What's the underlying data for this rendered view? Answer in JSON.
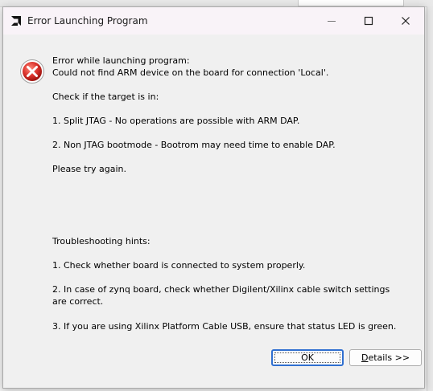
{
  "dialog": {
    "title": "Error Launching Program",
    "header_line1": "Error while launching program:",
    "header_line2": "Could not find ARM device on the board for connection 'Local'.",
    "check_intro": "Check if the target is in:",
    "check_item1": "1. Split JTAG - No operations are possible with ARM DAP.",
    "check_item2": "2. Non JTAG bootmode - Bootrom may need time to enable DAP.",
    "try_again": "Please try again.",
    "hints_title": "Troubleshooting hints:",
    "hint1": "1. Check whether board is connected to system properly.",
    "hint2": "2. In case of zynq board, check whether Digilent/Xilinx cable switch settings are correct.",
    "hint3": "3. If you are using Xilinx Platform Cable USB, ensure that status LED is green.",
    "ok_label": "OK",
    "details_label_underlined": "D",
    "details_label_rest": "etails >>"
  },
  "icons": {
    "app": "amd-logo-icon",
    "error": "error-icon",
    "minimize": "minimize-icon",
    "maximize": "maximize-icon",
    "close": "close-icon"
  },
  "colors": {
    "error_red": "#c42b1c",
    "focus_blue": "#2f6fd0",
    "titlebar_bg": "#f9f3f8"
  }
}
